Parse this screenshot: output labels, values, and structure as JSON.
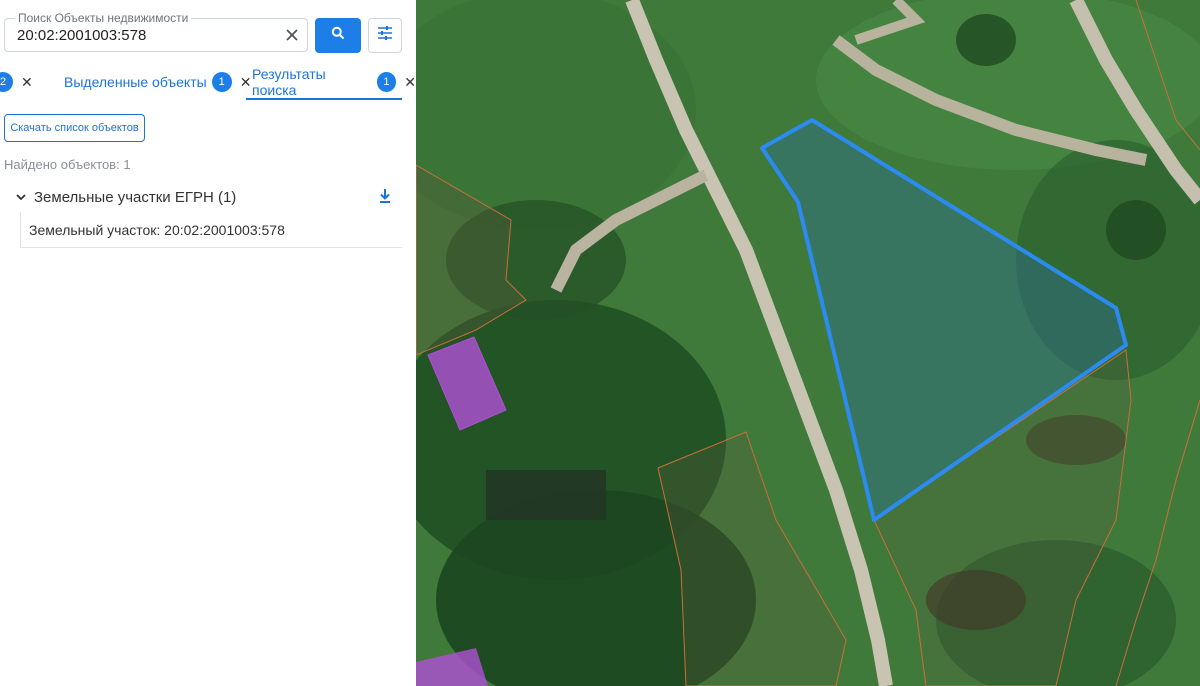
{
  "search": {
    "legend": "Поиск Объекты недвижимости",
    "value": "20:02:2001003:578"
  },
  "tabs": [
    {
      "label": "",
      "count": "2"
    },
    {
      "label": "Выделенные объекты",
      "count": "1"
    },
    {
      "label": "Результаты поиска",
      "count": "1"
    }
  ],
  "results": {
    "download_label": "Скачать список объектов",
    "found_text": "Найдено объектов: 1",
    "group_label": "Земельные участки ЕГРН (1)",
    "item_label": "Земельный участок: 20:02:2001003:578"
  },
  "icons": {
    "clear": "close-icon",
    "search": "search-icon",
    "filter": "tune-icon",
    "download": "download-icon",
    "chevron": "chevron-down-icon"
  },
  "colors": {
    "accent": "#1e7ee8",
    "selection_outline": "#2b8bf0",
    "parcel_border": "#c8703a",
    "highlight_parcel": "#b04fd6"
  }
}
